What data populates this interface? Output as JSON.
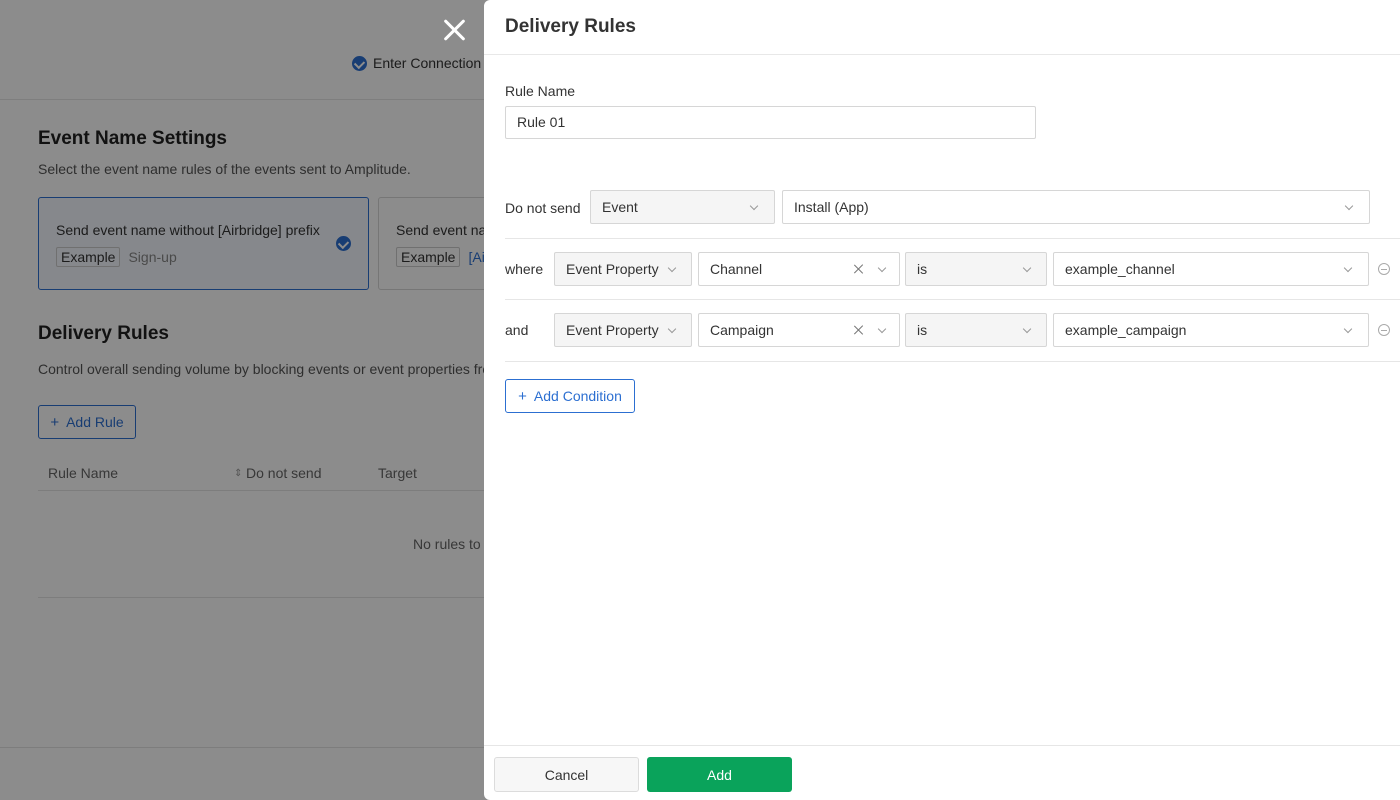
{
  "background": {
    "step_label": "Enter Connection",
    "event_name_settings": {
      "title": "Event Name Settings",
      "description": "Select the event name rules of the events sent to Amplitude.",
      "options": [
        {
          "title": "Send event name without [Airbridge] prefix",
          "example_tag": "Example",
          "example_value": "Sign-up",
          "selected": true
        },
        {
          "title": "Send event na",
          "example_tag": "Example",
          "example_value": "[Ai",
          "selected": false
        }
      ]
    },
    "delivery_rules": {
      "title": "Delivery Rules",
      "description": "Control overall sending volume by blocking events or event properties fro",
      "add_rule_label": "Add Rule",
      "columns": [
        "Rule Name",
        "Do not send",
        "Target"
      ],
      "empty_text": "No rules to"
    }
  },
  "drawer": {
    "title": "Delivery Rules",
    "rule_name_label": "Rule Name",
    "rule_name_value": "Rule 01",
    "do_not_send": {
      "label": "Do not send",
      "type": "Event",
      "target": "Install (App)"
    },
    "conditions": [
      {
        "connector": "where",
        "source": "Event Property",
        "property": "Channel",
        "operator": "is",
        "value": "example_channel"
      },
      {
        "connector": "and",
        "source": "Event Property",
        "property": "Campaign",
        "operator": "is",
        "value": "example_campaign"
      }
    ],
    "add_condition_label": "Add Condition",
    "footer": {
      "cancel_label": "Cancel",
      "add_label": "Add"
    }
  },
  "colors": {
    "accent": "#2c6fd1",
    "primary_button": "#0aa35b"
  }
}
